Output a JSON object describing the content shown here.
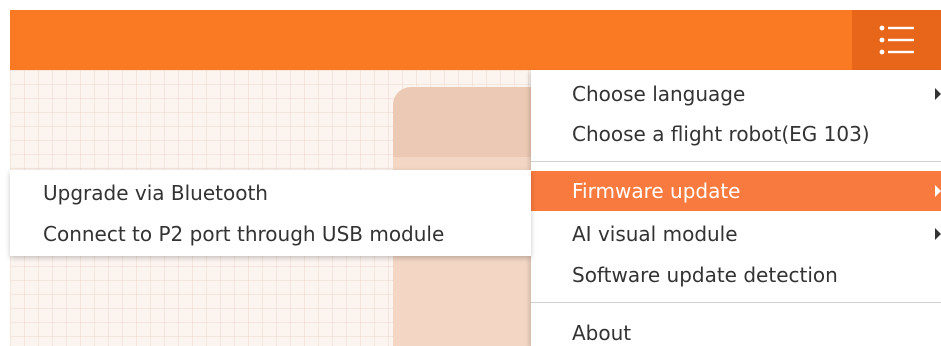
{
  "header": {
    "menu_icon": "hamburger-list-icon",
    "accent_color": "#f97a22"
  },
  "main_menu": {
    "items": [
      {
        "label": "Choose language",
        "has_submenu": true
      },
      {
        "label": "Choose a flight robot(EG 103)",
        "has_submenu": false
      },
      {
        "label": "Firmware update",
        "has_submenu": true,
        "active": true
      },
      {
        "label": "AI visual module",
        "has_submenu": true
      },
      {
        "label": "Software update detection",
        "has_submenu": false
      },
      {
        "label": "About",
        "has_submenu": false
      }
    ],
    "highlight_color": "#f97a3f"
  },
  "firmware_submenu": {
    "items": [
      {
        "label": "Upgrade via Bluetooth"
      },
      {
        "label": "Connect to P2 port through USB module"
      }
    ]
  }
}
